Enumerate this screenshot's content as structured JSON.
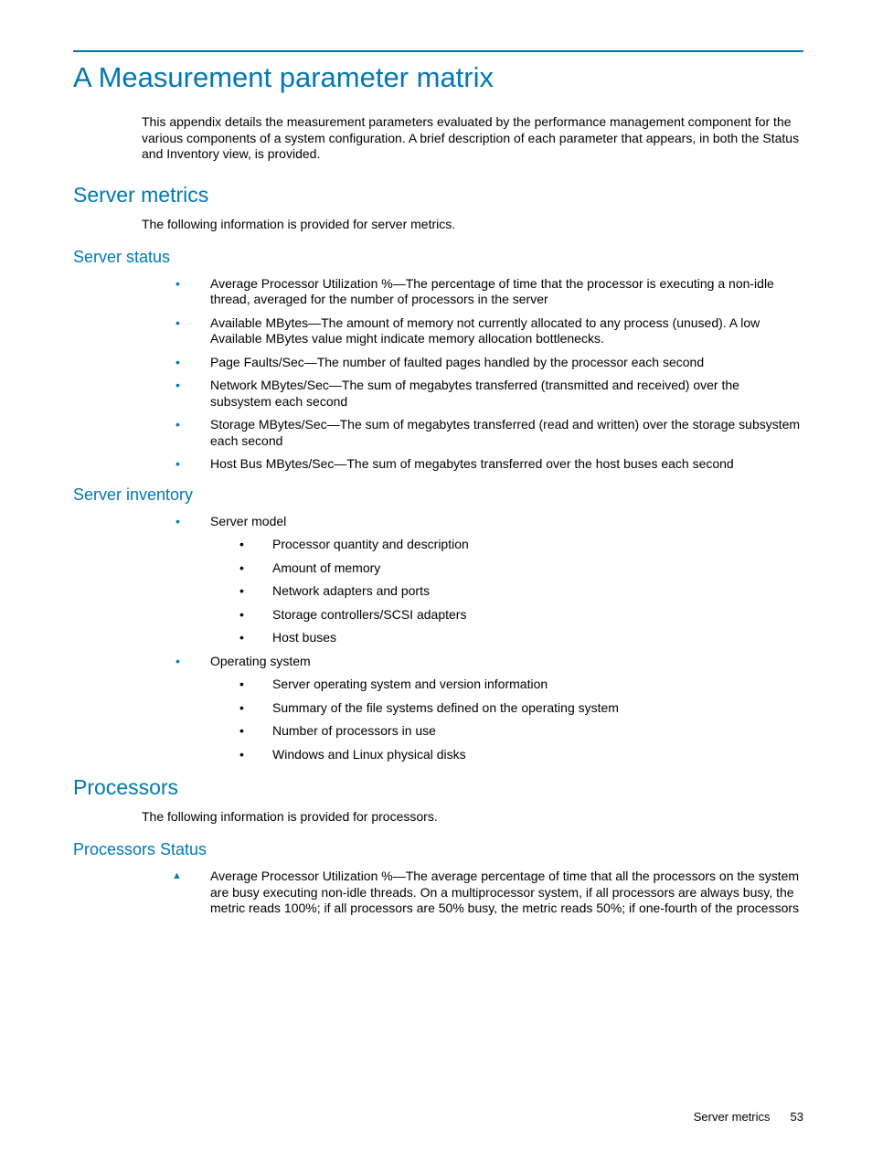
{
  "title": "A Measurement parameter matrix",
  "intro": "This appendix details the measurement parameters evaluated by the performance management component for the various components of a system configuration. A brief description of each parameter that appears, in both the Status and Inventory view, is provided.",
  "server_metrics": {
    "heading": "Server metrics",
    "intro": "The following information is provided for server metrics.",
    "status": {
      "heading": "Server status",
      "items": [
        "Average Processor Utilization %—The percentage of time that the processor is executing a non-idle thread, averaged for the number of processors in the server",
        "Available MBytes—The amount of memory not currently allocated to any process (unused). A low Available MBytes value might indicate memory allocation bottlenecks.",
        "Page Faults/Sec—The number of faulted pages handled by the processor each second",
        "Network MBytes/Sec—The sum of megabytes transferred (transmitted and received) over the subsystem each second",
        "Storage MBytes/Sec—The sum of megabytes transferred (read and written) over the storage subsystem each second",
        "Host Bus MBytes/Sec—The sum of megabytes transferred over the host buses each second"
      ]
    },
    "inventory": {
      "heading": "Server inventory",
      "groups": [
        {
          "label": "Server model",
          "items": [
            "Processor quantity and description",
            "Amount of memory",
            "Network adapters and ports",
            "Storage controllers/SCSI adapters",
            "Host buses"
          ]
        },
        {
          "label": "Operating system",
          "items": [
            "Server operating system and version information",
            "Summary of the file systems defined on the operating system",
            "Number of processors in use",
            "Windows and Linux physical disks"
          ]
        }
      ]
    }
  },
  "processors": {
    "heading": "Processors",
    "intro": "The following information is provided for processors.",
    "status": {
      "heading": "Processors Status",
      "items": [
        "Average Processor Utilization %—The average percentage of time that all the processors on the system are busy executing non-idle threads. On a multiprocessor system, if all processors are always busy, the metric reads 100%; if all processors are 50% busy, the metric reads 50%; if one-fourth of the processors"
      ]
    }
  },
  "footer": {
    "section": "Server metrics",
    "page": "53"
  }
}
